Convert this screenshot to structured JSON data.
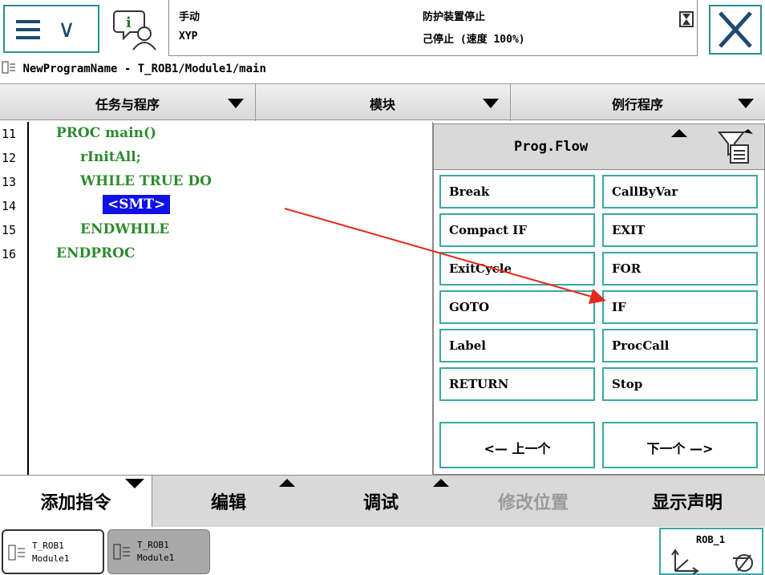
{
  "header": {
    "mode": "手动",
    "robot_name": "XYP",
    "safety_status": "防护装置停止",
    "run_status": "己停止 (速度 100%)"
  },
  "path": "NewProgramName - T_ROB1/Module1/main",
  "tabs": [
    {
      "label": "任务与程序"
    },
    {
      "label": "模块"
    },
    {
      "label": "例行程序"
    }
  ],
  "code": {
    "line_numbers": [
      "11",
      "12",
      "13",
      "14",
      "15",
      "16"
    ],
    "lines": [
      "PROC main()",
      "rInitAll;",
      "WHILE TRUE DO",
      "<SMT>",
      "ENDWHILE",
      "ENDPROC"
    ]
  },
  "panel": {
    "title": "Prog.Flow",
    "buttons": [
      "Break",
      "CallByVar",
      "Compact IF",
      "EXIT",
      "ExitCycle",
      "FOR",
      "GOTO",
      "IF",
      "Label",
      "ProcCall",
      "RETURN",
      "Stop"
    ],
    "prev_label": "<— 上一个",
    "next_label": "下一个 —>"
  },
  "toolbar": {
    "add_instruction": "添加指令",
    "edit": "编辑",
    "debug": "调试",
    "modify_position": "修改位置",
    "show_declaration": "显示声明"
  },
  "taskbar": {
    "tasks": [
      {
        "line1": "T_ROB1",
        "line2": "Module1"
      },
      {
        "line1": "T_ROB1",
        "line2": "Module1"
      }
    ],
    "robot": "ROB_1"
  },
  "colors": {
    "code_green": "#2e8b2e",
    "selection_blue": "#1010e8",
    "button_border": "#3aa7a7",
    "annotation_arrow": "#e32a1c"
  }
}
